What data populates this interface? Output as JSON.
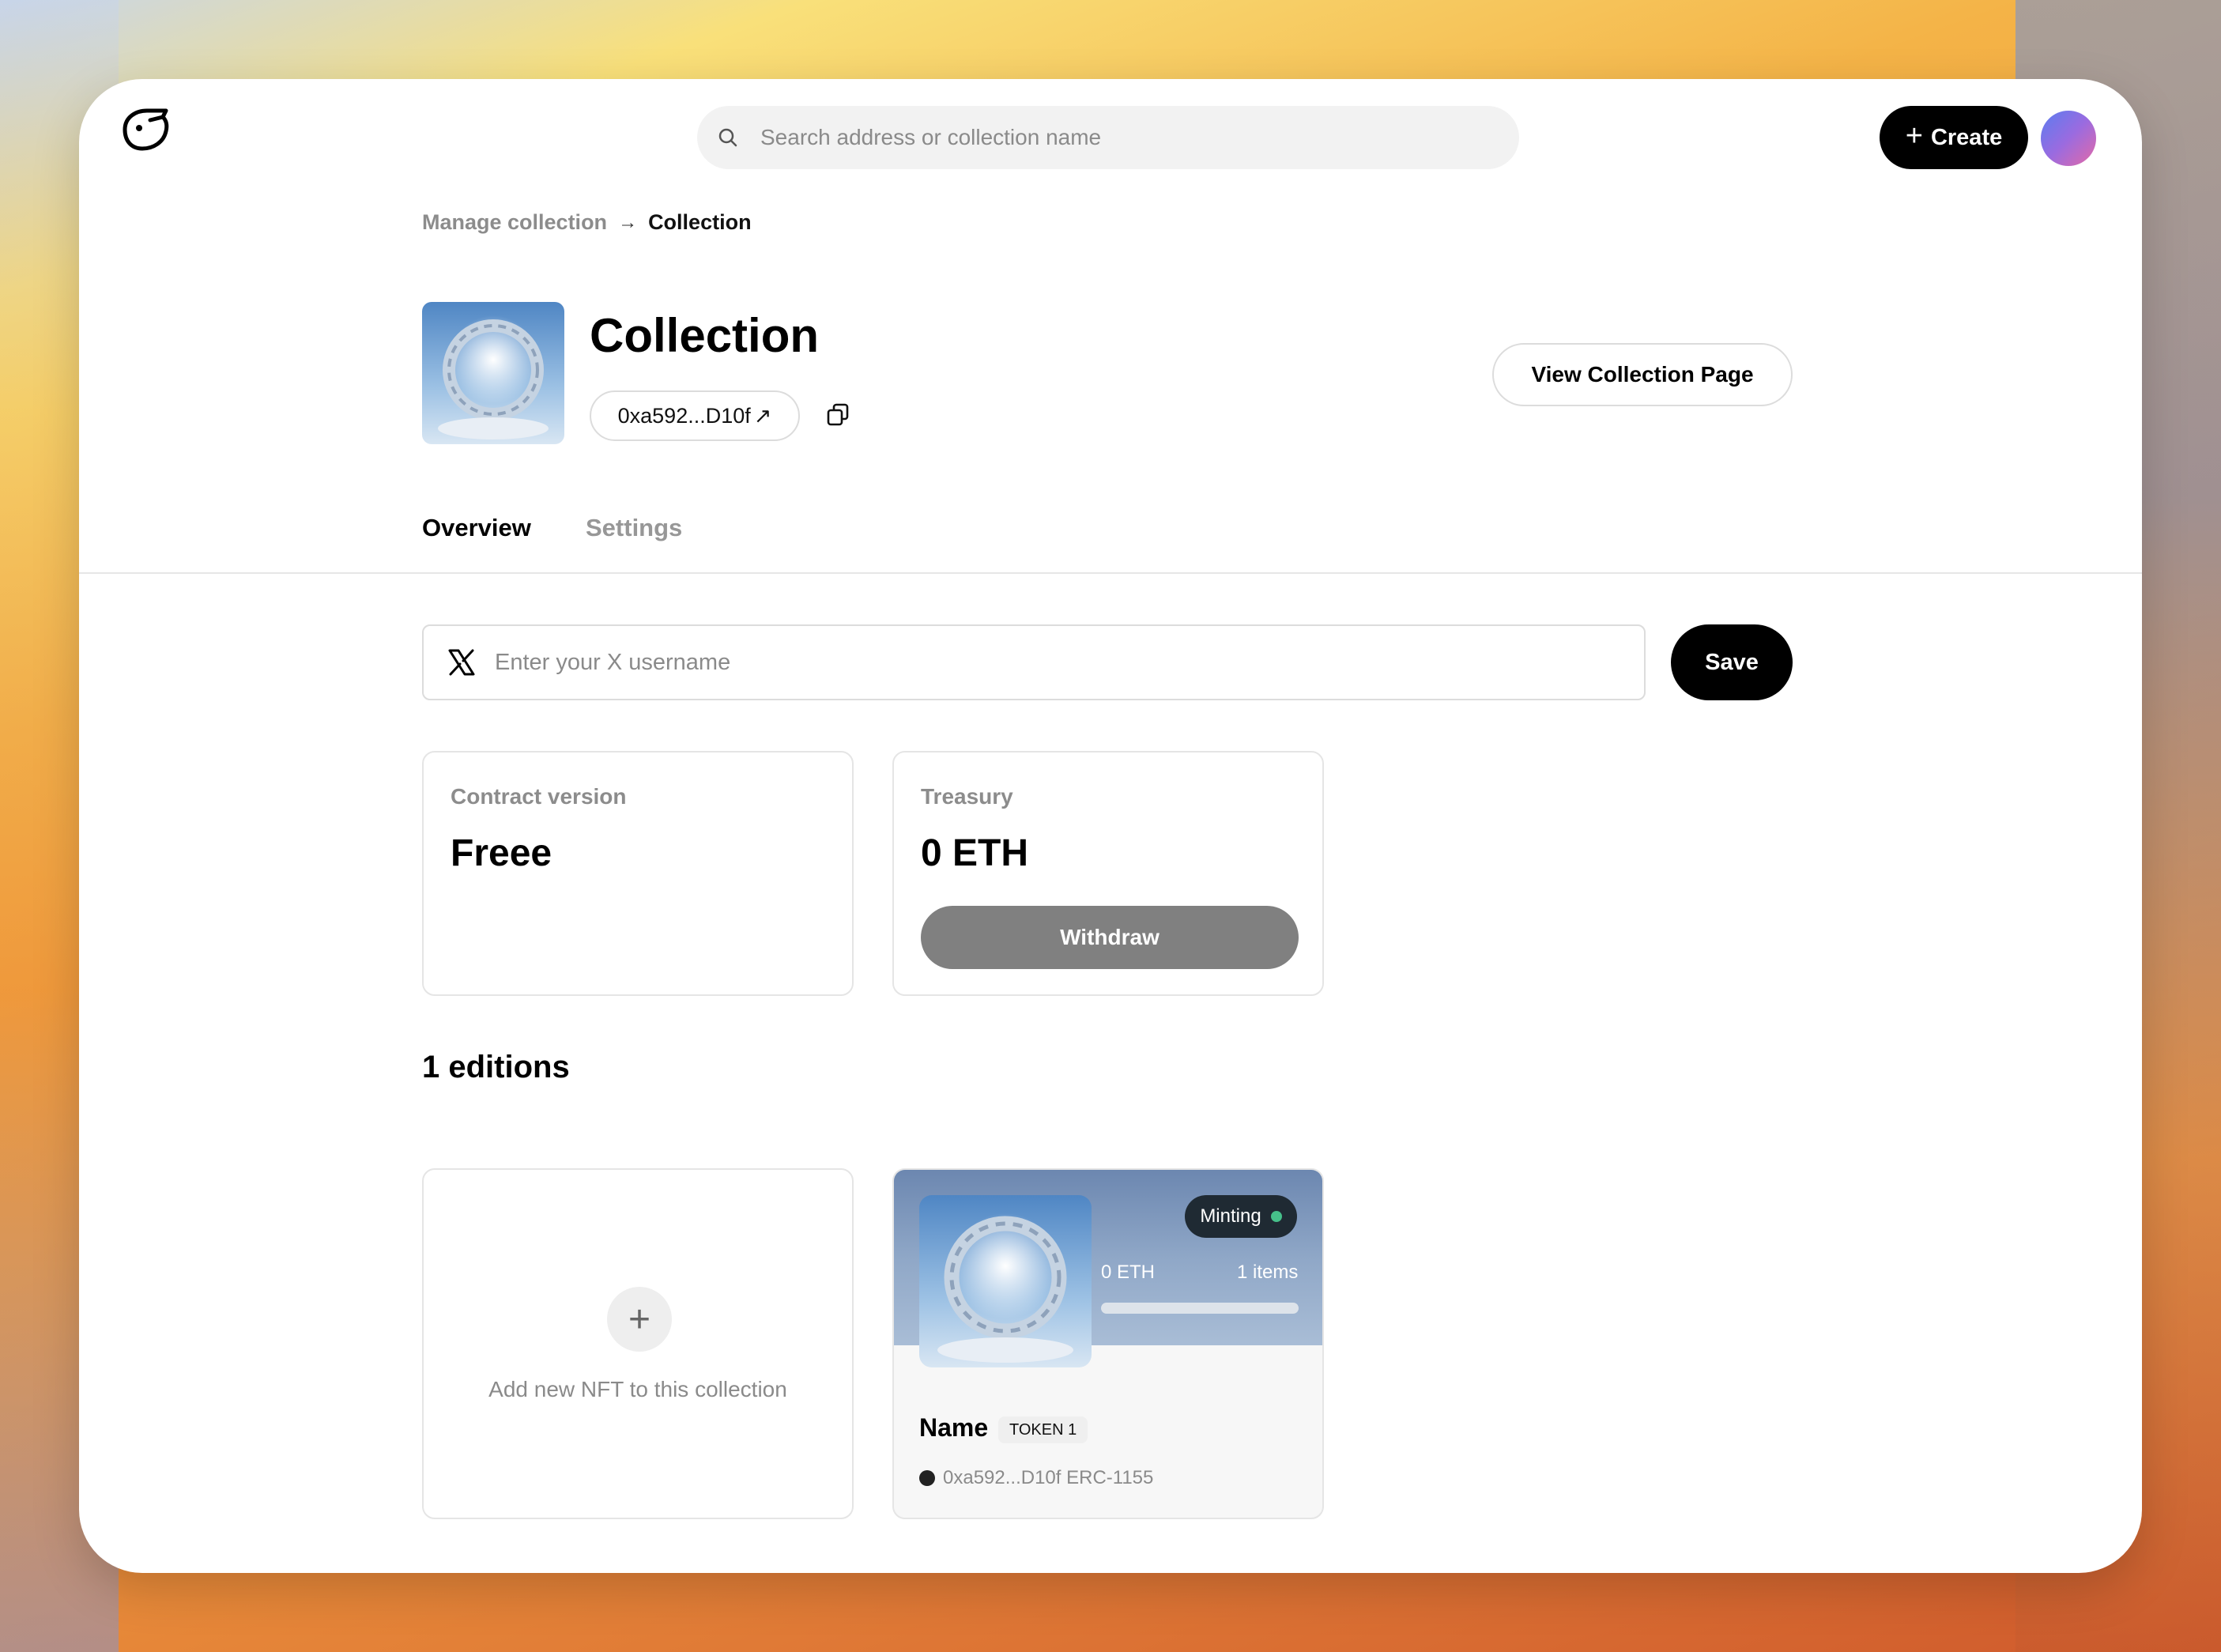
{
  "header": {
    "search_placeholder": "Search address or collection name",
    "create_label": "Create"
  },
  "breadcrumb": {
    "parent": "Manage collection",
    "current": "Collection"
  },
  "collection": {
    "title": "Collection",
    "address": "0xa592...D10f",
    "view_button": "View Collection Page"
  },
  "tabs": [
    {
      "label": "Overview",
      "active": true
    },
    {
      "label": "Settings",
      "active": false
    }
  ],
  "x_field": {
    "placeholder": "Enter your X username",
    "save_label": "Save"
  },
  "contract": {
    "label": "Contract version",
    "value": "Freee"
  },
  "treasury": {
    "label": "Treasury",
    "value": "0 ETH",
    "withdraw_label": "Withdraw"
  },
  "editions": {
    "title": "1 editions",
    "add_text": "Add new NFT to this collection"
  },
  "nft": {
    "status": "Minting",
    "price": "0 ETH",
    "items": "1 items",
    "progress": 0,
    "name": "Name",
    "token": "TOKEN 1",
    "meta": "0xa592...D10f ERC-1155"
  },
  "colors": {
    "accent": "#000000",
    "status_dot": "#46c08a",
    "withdraw_disabled": "#808080"
  },
  "icons": [
    "logo-icon",
    "search-icon",
    "plus-icon",
    "arrow-right-icon",
    "external-link-icon",
    "copy-icon",
    "x-logo-icon",
    "chain-icon"
  ]
}
